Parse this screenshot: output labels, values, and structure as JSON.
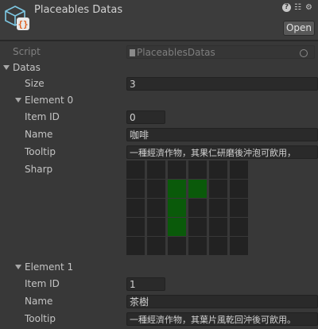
{
  "header": {
    "title": "Placeables Datas",
    "open_label": "Open",
    "icons": [
      "help-icon",
      "sliders-icon",
      "gear-icon"
    ]
  },
  "script": {
    "label": "Script",
    "value": "PlaceablesDatas"
  },
  "datas": {
    "label": "Datas",
    "size_label": "Size",
    "size_value": "3"
  },
  "elements": [
    {
      "label": "Element 0",
      "item_id_label": "Item ID",
      "item_id": "0",
      "name_label": "Name",
      "name": "咖啡",
      "tooltip_label": "Tooltip",
      "tooltip": "一種經濟作物，其果仁研磨後沖泡可飲用，",
      "sharp_label": "Sharp",
      "sharp": [
        [
          0,
          0,
          0,
          0,
          0,
          0
        ],
        [
          0,
          0,
          1,
          1,
          0,
          0
        ],
        [
          0,
          0,
          1,
          0,
          0,
          0
        ],
        [
          0,
          0,
          1,
          0,
          0,
          0
        ],
        [
          0,
          0,
          0,
          0,
          0,
          0
        ]
      ]
    },
    {
      "label": "Element 1",
      "item_id_label": "Item ID",
      "item_id": "1",
      "name_label": "Name",
      "name": "茶樹",
      "tooltip_label": "Tooltip",
      "tooltip": "一種經濟作物，其葉片風乾回沖後可飲用。"
    }
  ],
  "colors": {
    "sharp_on": "#0a5a0a",
    "sharp_off": "#222222",
    "bg": "#383838"
  }
}
